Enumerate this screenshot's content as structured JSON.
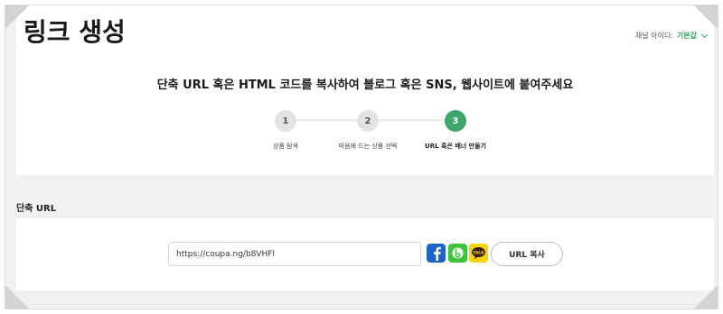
{
  "page": {
    "title": "링크 생성",
    "channel_label": "채널 아이디:",
    "channel_value": "기본값"
  },
  "instruction": "단축 URL 혹은 HTML 코드를 복사하여 블로그 혹은 SNS, 웹사이트에 붙여주세요",
  "steps": [
    {
      "number": "1",
      "label": "상품 탐색",
      "active": false
    },
    {
      "number": "2",
      "label": "마음에 드는 상품 선택",
      "active": false
    },
    {
      "number": "3",
      "label": "URL 혹은 배너 만들기",
      "active": true
    }
  ],
  "short_url": {
    "section_label": "단축 URL",
    "value": "https://coupa.ng/b8VHFl",
    "copy_label": "URL 복사",
    "share_icons": [
      "facebook-icon",
      "band-icon",
      "kakaotalk-icon"
    ],
    "kakao_icon_text": "TALK"
  },
  "colors": {
    "accent_green": "#3ea86b",
    "facebook": "#1e64cf",
    "band": "#3ec33c",
    "kakao": "#f7d500"
  }
}
